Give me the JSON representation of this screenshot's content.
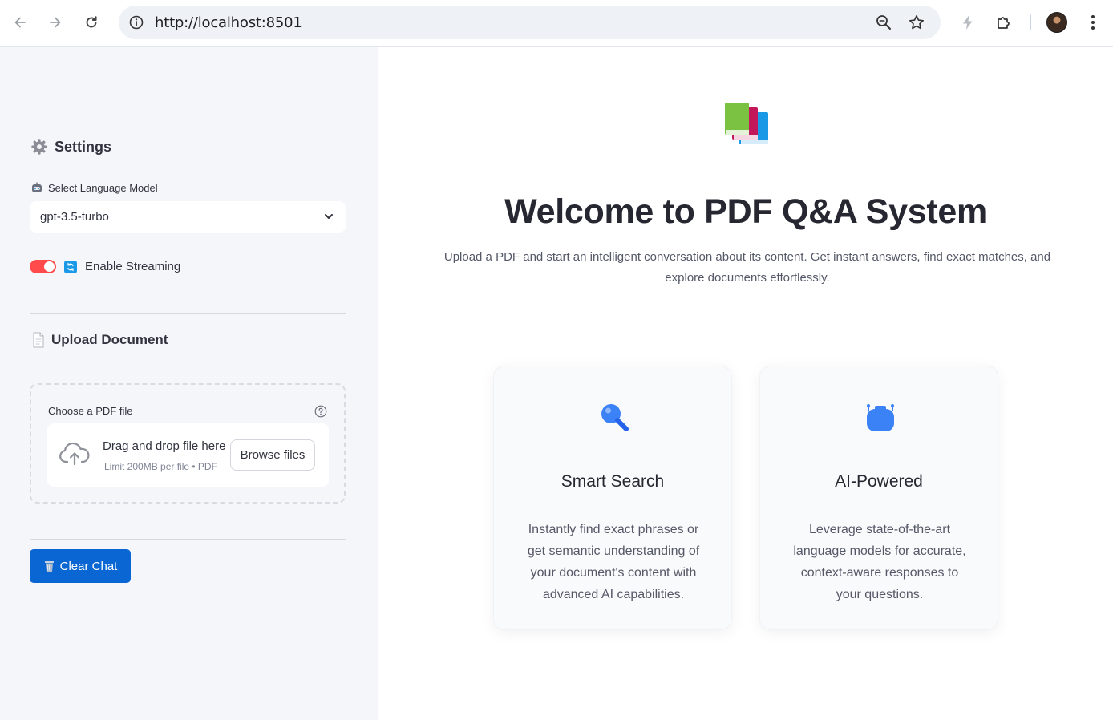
{
  "browser": {
    "url": "http://localhost:8501"
  },
  "sidebar": {
    "settings_title": "Settings",
    "model_label": "Select Language Model",
    "model_value": "gpt-3.5-turbo",
    "streaming_label": "Enable Streaming",
    "streaming_enabled": true,
    "upload_title": "Upload Document",
    "uploader_label": "Choose a PDF file",
    "drop_text": "Drag and drop file here",
    "limit_text": "Limit 200MB per file • PDF",
    "browse_label": "Browse files",
    "clear_label": "Clear Chat"
  },
  "main": {
    "title": "Welcome to PDF Q&A System",
    "subtitle": "Upload a PDF and start an intelligent conversation about its content. Get instant answers, find exact matches, and explore documents effortlessly.",
    "cards": [
      {
        "icon": "magnifier-icon",
        "title": "Smart Search",
        "text": "Instantly find exact phrases or get semantic understanding of your document's content with advanced AI capabilities."
      },
      {
        "icon": "robot-icon",
        "title": "AI-Powered",
        "text": "Leverage state-of-the-art language models for accurate, context-aware responses to your questions."
      }
    ]
  },
  "colors": {
    "accent_red": "#ff4b4b",
    "primary_blue": "#0a66d2",
    "sidebar_bg": "#f5f6f9"
  }
}
